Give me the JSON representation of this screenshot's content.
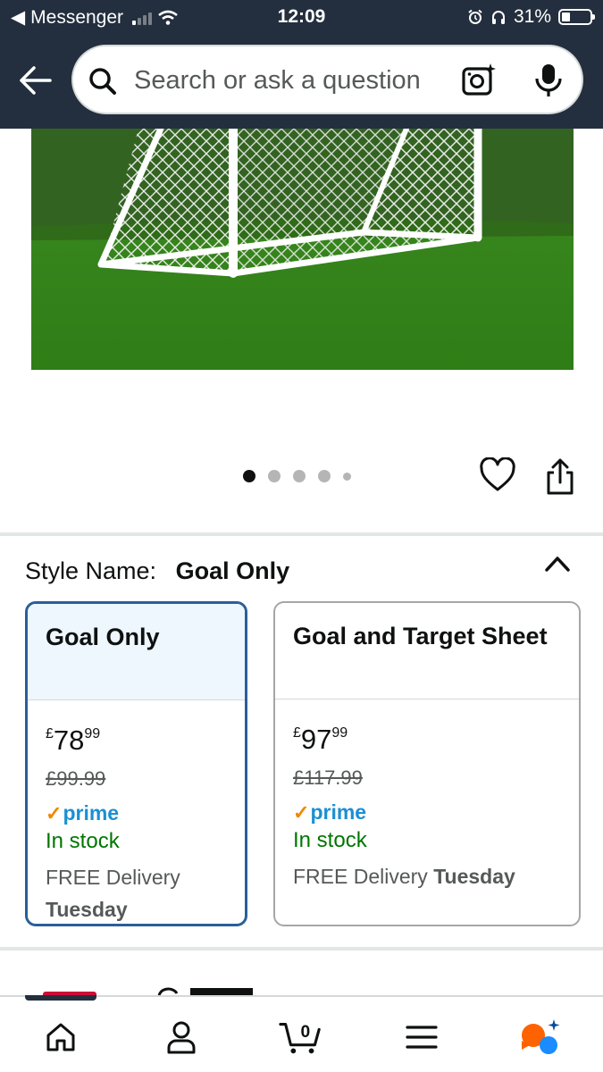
{
  "status_bar": {
    "back_app": "Messenger",
    "time": "12:09",
    "battery": "31%",
    "battery_level": 0.31
  },
  "search": {
    "placeholder": "Search or ask a question"
  },
  "gallery": {
    "total_images": 5,
    "current_index": 0
  },
  "variation": {
    "label": "Style Name:",
    "selected": "Goal Only"
  },
  "options": [
    {
      "name": "Goal Only",
      "price_symbol": "£",
      "price_whole": "78",
      "price_fraction": "99",
      "was_price": "£99.99",
      "prime": "prime",
      "stock": "In stock",
      "delivery_text": "FREE Delivery",
      "delivery_day": "Tuesday"
    },
    {
      "name": "Goal and Target Sheet",
      "price_symbol": "£",
      "price_whole": "97",
      "price_fraction": "99",
      "was_price": "£117.99",
      "prime": "prime",
      "stock": "In stock",
      "delivery_text": "FREE Delivery",
      "delivery_day": "Tuesday"
    }
  ],
  "tab_bar": {
    "cart_count": "0"
  },
  "colors": {
    "header": "#232f3e",
    "selected_border": "#2a5f98",
    "stock_green": "#007600",
    "prime_blue": "#1c8fd3",
    "prime_check": "#f08804"
  },
  "icons": [
    "back-arrow-icon",
    "search-icon",
    "camera-icon",
    "microphone-icon",
    "heart-icon",
    "share-icon",
    "chevron-up-icon",
    "home-icon",
    "account-icon",
    "cart-icon",
    "menu-icon",
    "rufus-icon"
  ]
}
